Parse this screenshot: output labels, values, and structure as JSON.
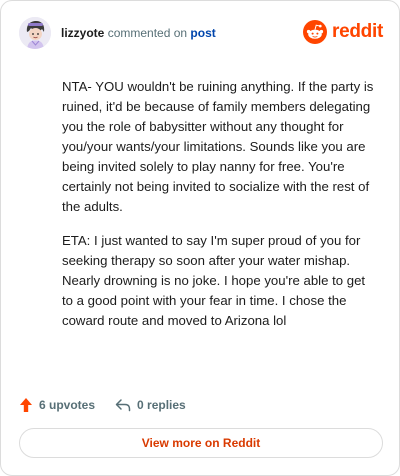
{
  "header": {
    "username": "lizzyote",
    "action": "commented on",
    "target": "post",
    "brand": "reddit"
  },
  "comment": {
    "paragraphs": [
      "NTA- YOU wouldn't be ruining anything. If the party is ruined, it'd be because of family members delegating you the role of babysitter without any thought for you/your wants/your limitations. Sounds like you are being invited solely to play nanny for free. You're certainly not being invited to socialize with the rest of the adults.",
      "ETA: I just wanted to say I'm super proud of you for seeking therapy so soon after your water mishap. Nearly drowning is no joke. I hope you're able to get to a good point with your fear in time. I chose the coward route and moved to Arizona lol"
    ]
  },
  "footer": {
    "upvotes": "6 upvotes",
    "replies": "0 replies"
  },
  "view_more_label": "View more on Reddit",
  "colors": {
    "brand": "#ff4500",
    "link": "#0045ac",
    "muted": "#576f76",
    "cta": "#d93a00"
  },
  "icons": {
    "avatar": "user-avatar",
    "brand": "reddit-snoo-icon",
    "upvote": "upvote-arrow-icon",
    "reply": "reply-arrow-icon"
  }
}
